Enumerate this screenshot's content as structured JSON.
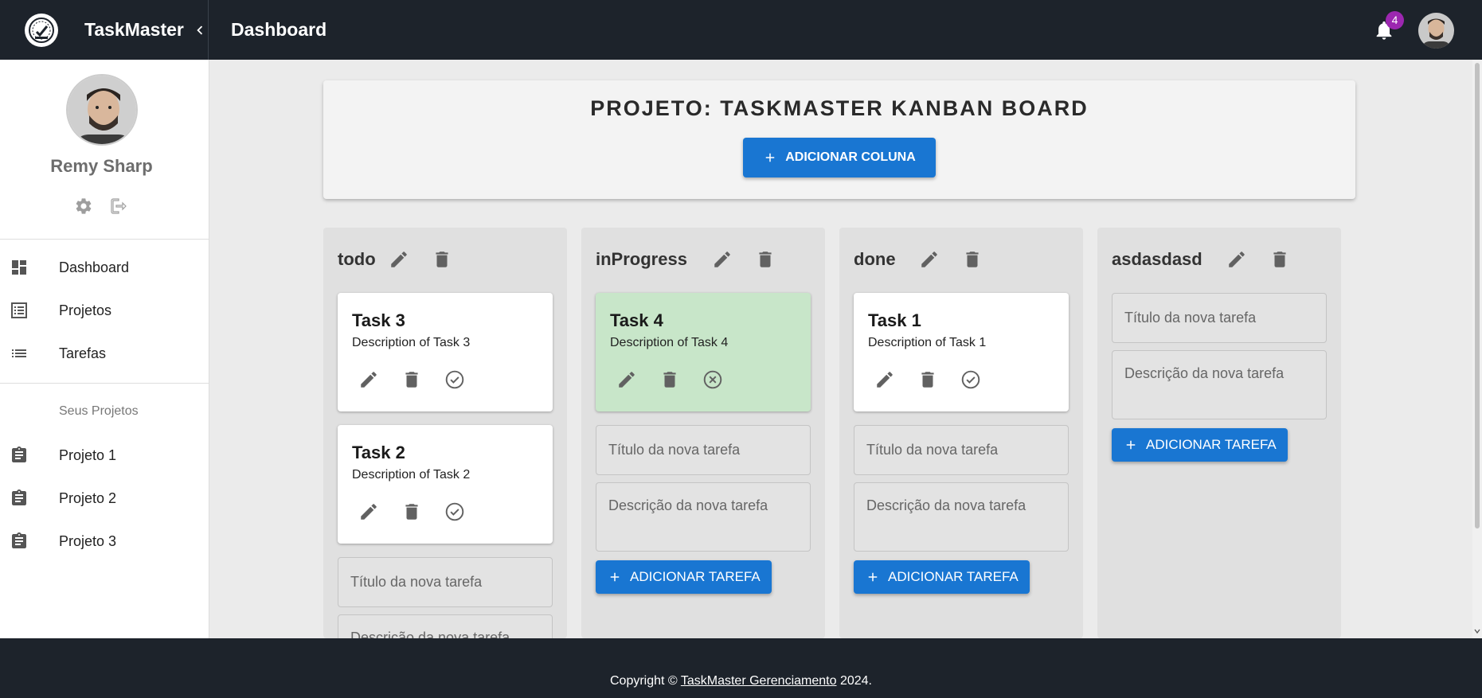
{
  "app": {
    "name": "TaskMaster",
    "page_title": "Dashboard"
  },
  "topbar": {
    "notification_count": "4"
  },
  "user": {
    "name": "Remy Sharp"
  },
  "sidebar": {
    "nav": [
      {
        "label": "Dashboard",
        "icon": "dashboard-icon"
      },
      {
        "label": "Projetos",
        "icon": "list-alt-icon"
      },
      {
        "label": "Tarefas",
        "icon": "list-icon"
      }
    ],
    "section_label": "Seus Projetos",
    "projects": [
      {
        "label": "Projeto 1",
        "icon": "assignment-icon"
      },
      {
        "label": "Projeto 2",
        "icon": "assignment-icon"
      },
      {
        "label": "Projeto 3",
        "icon": "assignment-icon"
      }
    ]
  },
  "board": {
    "title": "PROJETO: TASKMASTER KANBAN BOARD",
    "add_column_label": "ADICIONAR COLUNA",
    "new_task_title_placeholder": "Título da nova tarefa",
    "new_task_desc_placeholder": "Descrição da nova tarefa",
    "add_task_label": "ADICIONAR TAREFA",
    "columns": [
      {
        "name": "todo",
        "tasks": [
          {
            "title": "Task 3",
            "description": "Description of Task 3",
            "completed": false
          },
          {
            "title": "Task 2",
            "description": "Description of Task 2",
            "completed": false
          }
        ]
      },
      {
        "name": "inProgress",
        "tasks": [
          {
            "title": "Task 4",
            "description": "Description of Task 4",
            "completed": true
          }
        ]
      },
      {
        "name": "done",
        "tasks": [
          {
            "title": "Task 1",
            "description": "Description of Task 1",
            "completed": false
          }
        ]
      },
      {
        "name": "asdasdasd",
        "tasks": []
      }
    ]
  },
  "colors": {
    "primary": "#1976d2",
    "appbar": "#1d232b",
    "badge": "#9c27b0",
    "completed_card": "#c8e6c9",
    "column_bg": "#e0e0e0"
  },
  "footer": {
    "prefix": "Copyright ©",
    "link": "TaskMaster Gerenciamento",
    "suffix": "2024."
  }
}
